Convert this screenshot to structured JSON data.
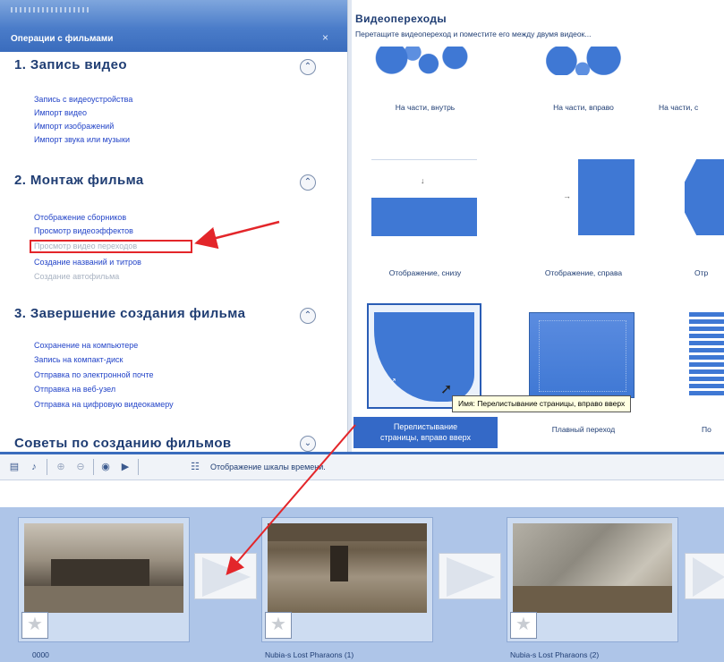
{
  "task_pane": {
    "header_title": "Операции с фильмами",
    "close_glyph": "×",
    "sections": [
      {
        "title": "1. Запись видео",
        "links": [
          "Запись с видеоустройства",
          "Импорт видео",
          "Импорт изображений",
          "Импорт звука или музыки"
        ]
      },
      {
        "title": "2. Монтаж фильма",
        "links": [
          "Отображение сборников",
          "Просмотр видеоэффектов",
          "Просмотр видео переходов",
          "Создание названий и титров",
          "Создание автофильма"
        ]
      },
      {
        "title": "3. Завершение создания фильма",
        "links": [
          "Сохранение на компьютере",
          "Запись на компакт-диск",
          "Отправка по электронной почте",
          "Отправка на веб-узел",
          "Отправка на цифровую видеокамеру"
        ]
      },
      {
        "title": "Советы по созданию фильмов",
        "links": []
      }
    ],
    "collapse_glyph": "⌃",
    "expand_glyph": "⌄",
    "highlighted_link": "Просмотр видео переходов",
    "disabled_link": "Создание автофильма"
  },
  "collection": {
    "title": "Видеопереходы",
    "subtitle": "Перетащите видеопереход и поместите его между двумя видеок...",
    "transitions": [
      "На части, внутрь",
      "На части, вправо",
      "На части, с",
      "Отображение, снизу",
      "Отображение, справа",
      "Отр",
      "Перелистывание страницы, вправо вверх",
      "Плавный переход",
      "По"
    ],
    "selected_caption_line1": "Перелистывание",
    "selected_caption_line2": "страницы, вправо вверх",
    "tooltip": "Имя: Перелистывание страницы, вправо вверх"
  },
  "storyboard": {
    "toolbar_timeline_label": "Отображение шкалы времени.",
    "clips": [
      {
        "name": "0000"
      },
      {
        "name": "Nubia-s Lost Pharaons (1)"
      },
      {
        "name": "Nubia-s Lost Pharaons (2)"
      }
    ]
  },
  "colors": {
    "accent": "#3a6cbd",
    "link": "#2445c8",
    "annotation_red": "#e3262a",
    "thumb_blue": "#3f78d4",
    "storyboard_bg": "#aec5e8"
  },
  "icons": [
    "storyboard-icon",
    "narrate-icon",
    "zoom-in-icon",
    "zoom-out-icon",
    "rewind-icon",
    "play-icon",
    "timeline-icon",
    "star-effect-icon",
    "transition-arrow-icon"
  ]
}
